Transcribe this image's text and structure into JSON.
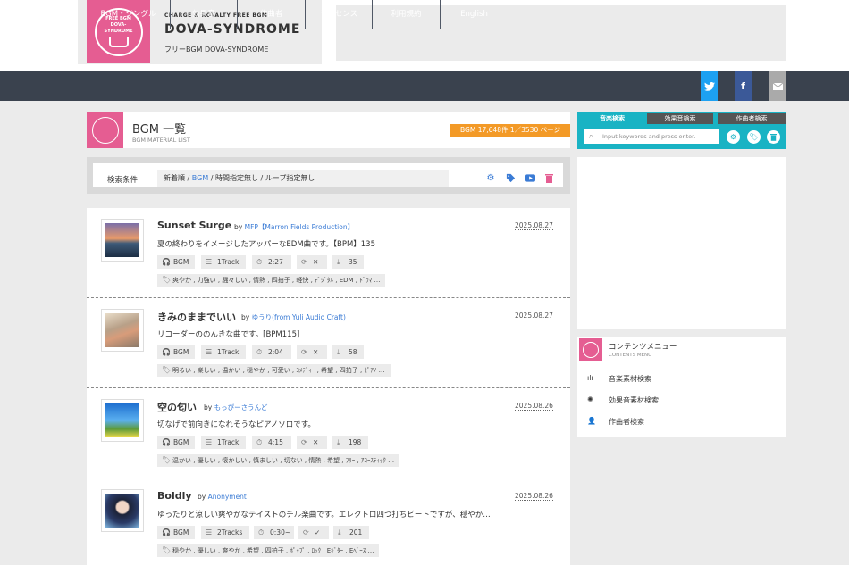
{
  "brand": {
    "logo_text": "FREE BGM DOVA-SYNDROME",
    "tagline": "CHARGE & ROYALTY FREE BGM",
    "name": "DOVA-SYNDROME",
    "subtitle": "フリーBGM DOVA-SYNDROME"
  },
  "nav": {
    "items": [
      "BGM・ジングル",
      "効果音",
      "作曲者",
      "ライセンス",
      "利用規約",
      "English"
    ],
    "social": [
      "twitter-icon",
      "facebook-icon",
      "mail-icon"
    ]
  },
  "colors": {
    "pink": "#e55d92",
    "nav": "#3a424e",
    "teal": "#19b3c4",
    "orange": "#f39a27",
    "link": "#3a7bd5"
  },
  "page": {
    "title": "BGM 一覧",
    "subtitle": "BGM MATERIAL LIST",
    "count": "BGM 17,648件  1／3530 ページ"
  },
  "filter": {
    "label": "検索条件",
    "parts": [
      "新着順",
      "BGM",
      "時間指定無し",
      "ループ指定無し"
    ],
    "sep": " / "
  },
  "items": [
    {
      "title": "Sunset Surge",
      "by": "by",
      "author": "MFP【Marron Fields Production】",
      "date": "2025.08.27",
      "desc": "夏の終わりをイメージしたアッパーなEDM曲です。【BPM】135",
      "type": "BGM",
      "tracks": "1Track",
      "length": "2:27",
      "loop": "✕",
      "downloads": "35",
      "tags": "爽やか , 力強い , 騒々しい , 情熱 , 四拍子 , 軽快 , ﾃﾞｼﾞﾀﾙ , EDM , ﾄﾞﾗﾏ …"
    },
    {
      "title": "きみのままでいい",
      "by": "by",
      "author": "ゆうり(from Yuli Audio Craft)",
      "date": "2025.08.27",
      "desc": "リコーダーののんきな曲です。[BPM115]",
      "type": "BGM",
      "tracks": "1Track",
      "length": "2:04",
      "loop": "✕",
      "downloads": "58",
      "tags": "明るい , 楽しい , 温かい , 穏やか , 可愛い , ｺﾒﾃﾞｨｰ , 希望 , 四拍子 , ﾋﾟｱﾉ …"
    },
    {
      "title": "空の匂い",
      "by": "by",
      "author": "もっぴーさうんど",
      "date": "2025.08.26",
      "desc": "切なげで前向きになれそうなピアノソロです。",
      "type": "BGM",
      "tracks": "1Track",
      "length": "4:15",
      "loop": "✕",
      "downloads": "198",
      "tags": "温かい , 優しい , 懐かしい , 慎ましい , 切ない , 情熱 , 希望 , ﾌﾘｰ , ｱｺｰｽﾃｨｯｸ …"
    },
    {
      "title": "Boldly",
      "by": "by",
      "author": "Anonyment",
      "date": "2025.08.26",
      "desc": "ゆったりと涼しい爽やかなテイストのチル楽曲です。エレクトロ四つ打ちビートですが、穏やか…",
      "type": "BGM",
      "tracks": "2Tracks",
      "length": "0:30~",
      "loop": "✓",
      "downloads": "201",
      "tags": "穏やか , 優しい , 爽やか , 希望 , 四拍子 , ﾎﾟｯﾌﾟ , ﾛｯｸ , Eｷﾞﾀｰ , Eﾍﾞｰｽ …"
    }
  ],
  "sidebar": {
    "tabs": [
      "音楽検索",
      "効果音検索",
      "作曲者検索"
    ],
    "placeholder": "Input keywords and press enter.",
    "menu_title": "コンテンツメニュー",
    "menu_sub": "CONTENTS MENU",
    "menu_items": [
      "音楽素材検索",
      "効果音素材検索",
      "作曲者検索"
    ]
  }
}
